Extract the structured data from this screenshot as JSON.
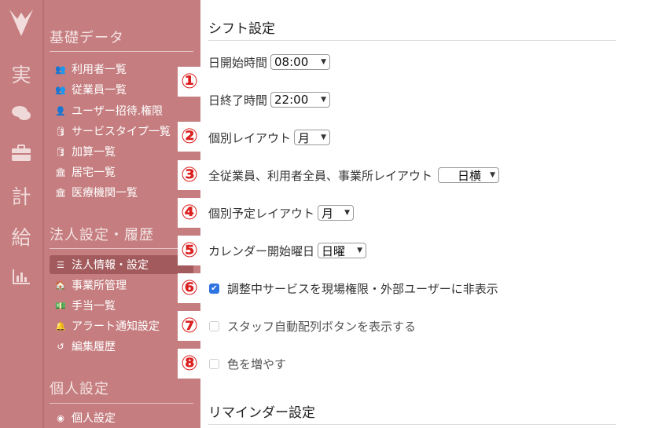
{
  "rail": {
    "items": [
      {
        "name": "rail-actual",
        "glyph": "実"
      },
      {
        "name": "rail-chat",
        "glyph": "💬"
      },
      {
        "name": "rail-business",
        "glyph": "💼"
      },
      {
        "name": "rail-plan",
        "glyph": "計"
      },
      {
        "name": "rail-salary",
        "glyph": "給"
      },
      {
        "name": "rail-chart",
        "glyph": "📊"
      }
    ]
  },
  "sidebar": {
    "sections": [
      {
        "title": "基礎データ",
        "items": [
          {
            "icon": "users-icon",
            "label": "利用者一覧"
          },
          {
            "icon": "users-icon",
            "label": "従業員一覧"
          },
          {
            "icon": "user-plus-icon",
            "label": "ユーザー招待.権限"
          },
          {
            "icon": "database-icon",
            "label": "サービスタイプ一覧"
          },
          {
            "icon": "database-icon",
            "label": "加算一覧"
          },
          {
            "icon": "building-icon",
            "label": "居宅一覧"
          },
          {
            "icon": "building-icon",
            "label": "医療機関一覧"
          }
        ]
      },
      {
        "title": "法人設定・履歴",
        "items": [
          {
            "icon": "sliders-icon",
            "label": "法人情報・設定",
            "active": true
          },
          {
            "icon": "home-icon",
            "label": "事業所管理"
          },
          {
            "icon": "money-icon",
            "label": "手当一覧"
          },
          {
            "icon": "bell-icon",
            "label": "アラート通知設定"
          },
          {
            "icon": "history-icon",
            "label": "編集履歴"
          }
        ]
      },
      {
        "title": "個人設定",
        "items": [
          {
            "icon": "user-circle-icon",
            "label": "個人設定"
          }
        ]
      }
    ]
  },
  "callouts": [
    "①",
    "②",
    "③",
    "④",
    "⑤",
    "⑥",
    "⑦",
    "⑧"
  ],
  "main": {
    "shift_title": "シフト設定",
    "day_start_label": "日開始時間",
    "day_start_value": "08:00",
    "day_end_label": "日終了時間",
    "day_end_value": "22:00",
    "individual_layout_label": "個別レイアウト",
    "individual_layout_value": "月",
    "all_layout_label": "全従業員、利用者全員、事業所レイアウト",
    "all_layout_value": "日横",
    "individual_plan_layout_label": "個別予定レイアウト",
    "individual_plan_layout_value": "月",
    "calendar_start_label": "カレンダー開始曜日",
    "calendar_start_value": "日曜",
    "hide_pending_label": "調整中サービスを現場権限・外部ユーザーに非表示",
    "hide_pending_checked": true,
    "show_auto_assign_label": "スタッフ自動配列ボタンを表示する",
    "show_auto_assign_checked": false,
    "more_colors_label": "色を増やす",
    "more_colors_checked": false,
    "reminder_title": "リマインダー設定"
  },
  "colors": {
    "sidebar_bg": "#c57d7f",
    "active_bg": "#a35a5c",
    "callout_red": "#dc1f1f",
    "checkbox_blue": "#2f74e0"
  }
}
